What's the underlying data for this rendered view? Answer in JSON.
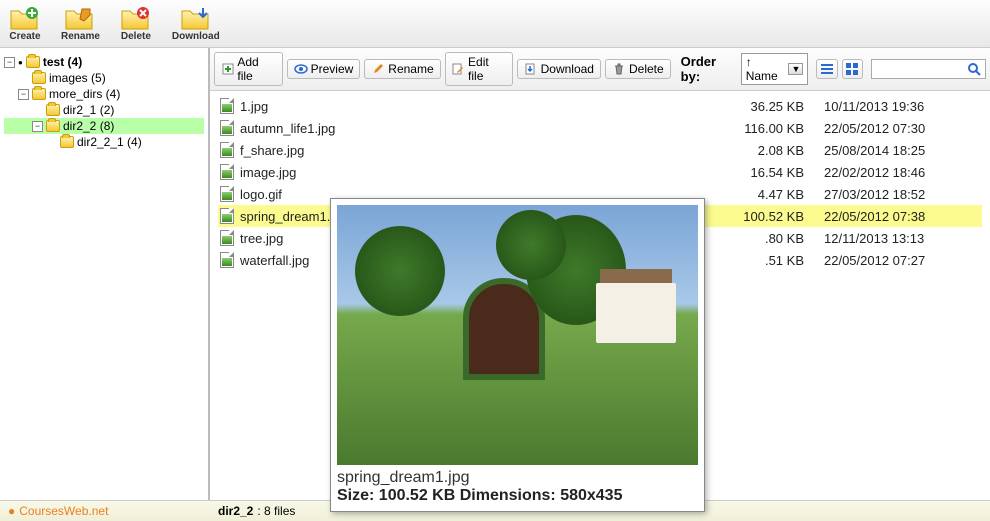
{
  "toolbar": [
    {
      "name": "create-button",
      "label": "Create",
      "icon": "folder-plus"
    },
    {
      "name": "rename-button",
      "label": "Rename",
      "icon": "folder-pencil"
    },
    {
      "name": "delete-button",
      "label": "Delete",
      "icon": "folder-x"
    },
    {
      "name": "download-button",
      "label": "Download",
      "icon": "folder-down"
    }
  ],
  "actions": [
    {
      "name": "add-file-button",
      "label": "Add file",
      "icon": "plus",
      "color": "#2a9a2a"
    },
    {
      "name": "preview-button",
      "label": "Preview",
      "icon": "eye",
      "color": "#2a6ad0"
    },
    {
      "name": "rename-file-button",
      "label": "Rename",
      "icon": "pencil",
      "color": "#e08a1a"
    },
    {
      "name": "edit-file-button",
      "label": "Edit file",
      "icon": "edit",
      "color": "#e08a1a"
    },
    {
      "name": "download-file-button",
      "label": "Download",
      "icon": "down",
      "color": "#2a6ad0"
    },
    {
      "name": "delete-file-button",
      "label": "Delete",
      "icon": "trash",
      "color": "#777"
    }
  ],
  "order": {
    "label": "Order by:",
    "selected": "↑ Name"
  },
  "tree": [
    {
      "name": "tree-root",
      "label": "test (4)",
      "exp": "-",
      "depth": 0,
      "sel": false,
      "dot": true
    },
    {
      "name": "tree-images",
      "label": "images (5)",
      "exp": "",
      "depth": 1,
      "sel": false
    },
    {
      "name": "tree-more-dirs",
      "label": "more_dirs (4)",
      "exp": "-",
      "depth": 1,
      "sel": false
    },
    {
      "name": "tree-dir2-1",
      "label": "dir2_1 (2)",
      "exp": "",
      "depth": 2,
      "sel": false
    },
    {
      "name": "tree-dir2-2",
      "label": "dir2_2 (8)",
      "exp": "-",
      "depth": 2,
      "sel": true
    },
    {
      "name": "tree-dir2-2-1",
      "label": "dir2_2_1 (4)",
      "exp": "",
      "depth": 3,
      "sel": false
    }
  ],
  "files": [
    {
      "name": "1.jpg",
      "size": "36.25 KB",
      "date": "10/11/2013 19:36",
      "sel": false
    },
    {
      "name": "autumn_life1.jpg",
      "size": "116.00 KB",
      "date": "22/05/2012 07:30",
      "sel": false
    },
    {
      "name": "f_share.jpg",
      "size": "2.08 KB",
      "date": "25/08/2014 18:25",
      "sel": false
    },
    {
      "name": "image.jpg",
      "size": "16.54 KB",
      "date": "22/02/2012 18:46",
      "sel": false
    },
    {
      "name": "logo.gif",
      "size": "4.47 KB",
      "date": "27/03/2012 18:52",
      "sel": false
    },
    {
      "name": "spring_dream1.jpg",
      "size": "100.52 KB",
      "date": "22/05/2012 07:38",
      "sel": true
    },
    {
      "name": "tree.jpg",
      "size": ".80 KB",
      "date": "12/11/2013 13:13",
      "sel": false
    },
    {
      "name": "waterfall.jpg",
      "size": ".51 KB",
      "date": "22/05/2012 07:27",
      "sel": false
    }
  ],
  "preview": {
    "filename": "spring_dream1.jpg",
    "info": "Size: 100.52 KB Dimensions: 580x435"
  },
  "status": {
    "site": "CoursesWeb.net",
    "path": "dir2_2",
    "count": ": 8 files"
  }
}
